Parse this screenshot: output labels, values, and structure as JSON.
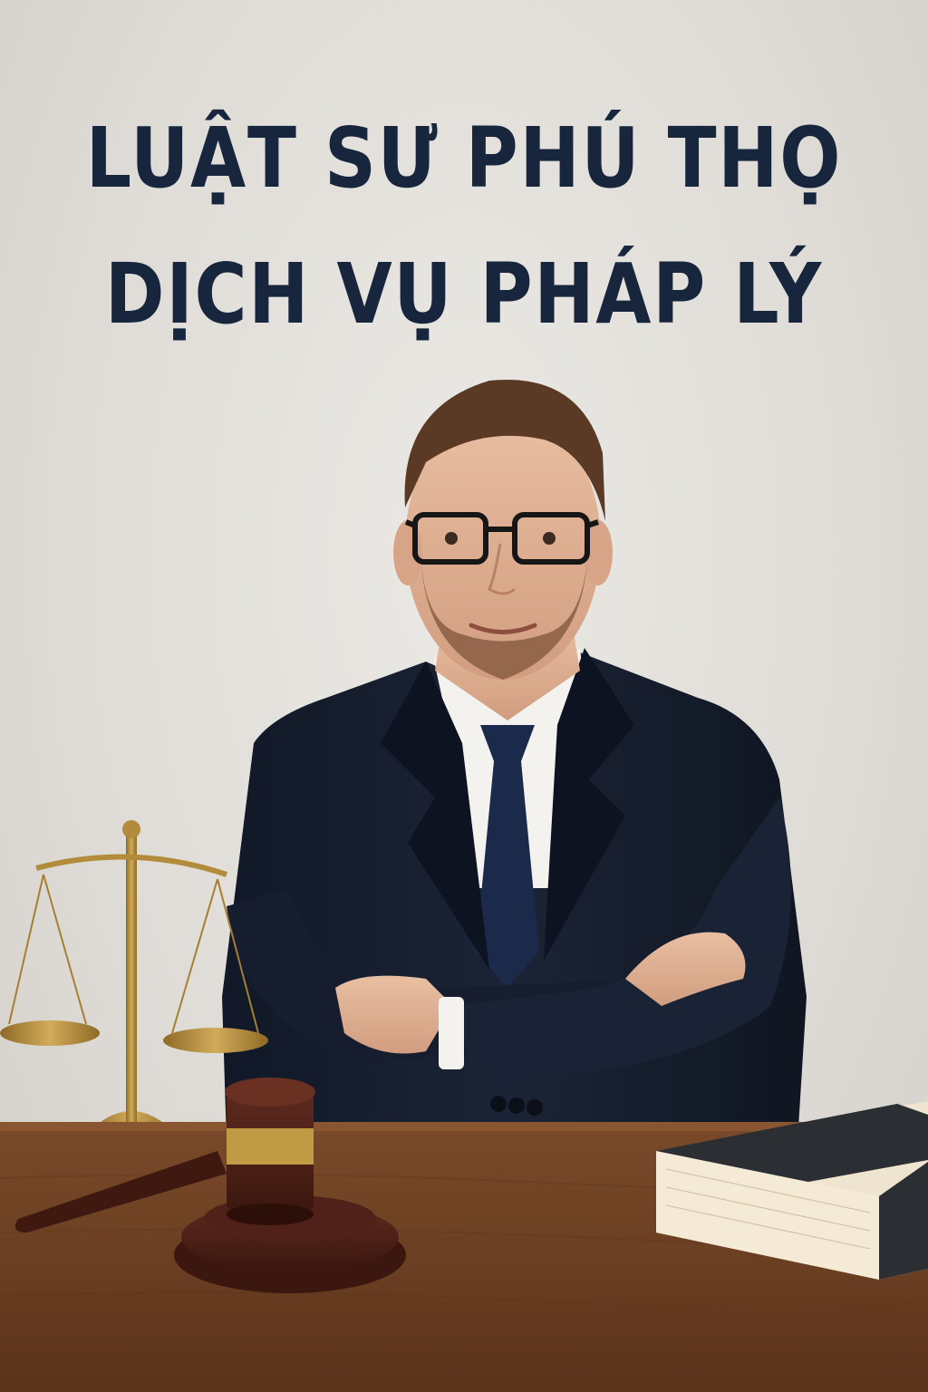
{
  "poster": {
    "title_line_1": "LUẬT SƯ PHÚ THỌ",
    "title_line_2": "DỊCH VỤ PHÁP LÝ"
  },
  "colors": {
    "background": "#e3e0db",
    "title": "#17253d",
    "suit": "#141c2b",
    "tie": "#1b2a4a",
    "desk": "#6e4225",
    "brass": "#b38b3c",
    "gavel": "#4a1f17",
    "book": "#2b2f33"
  },
  "icons": {
    "scales": "scales-of-justice-icon",
    "gavel": "gavel-icon",
    "book": "law-book-icon"
  }
}
